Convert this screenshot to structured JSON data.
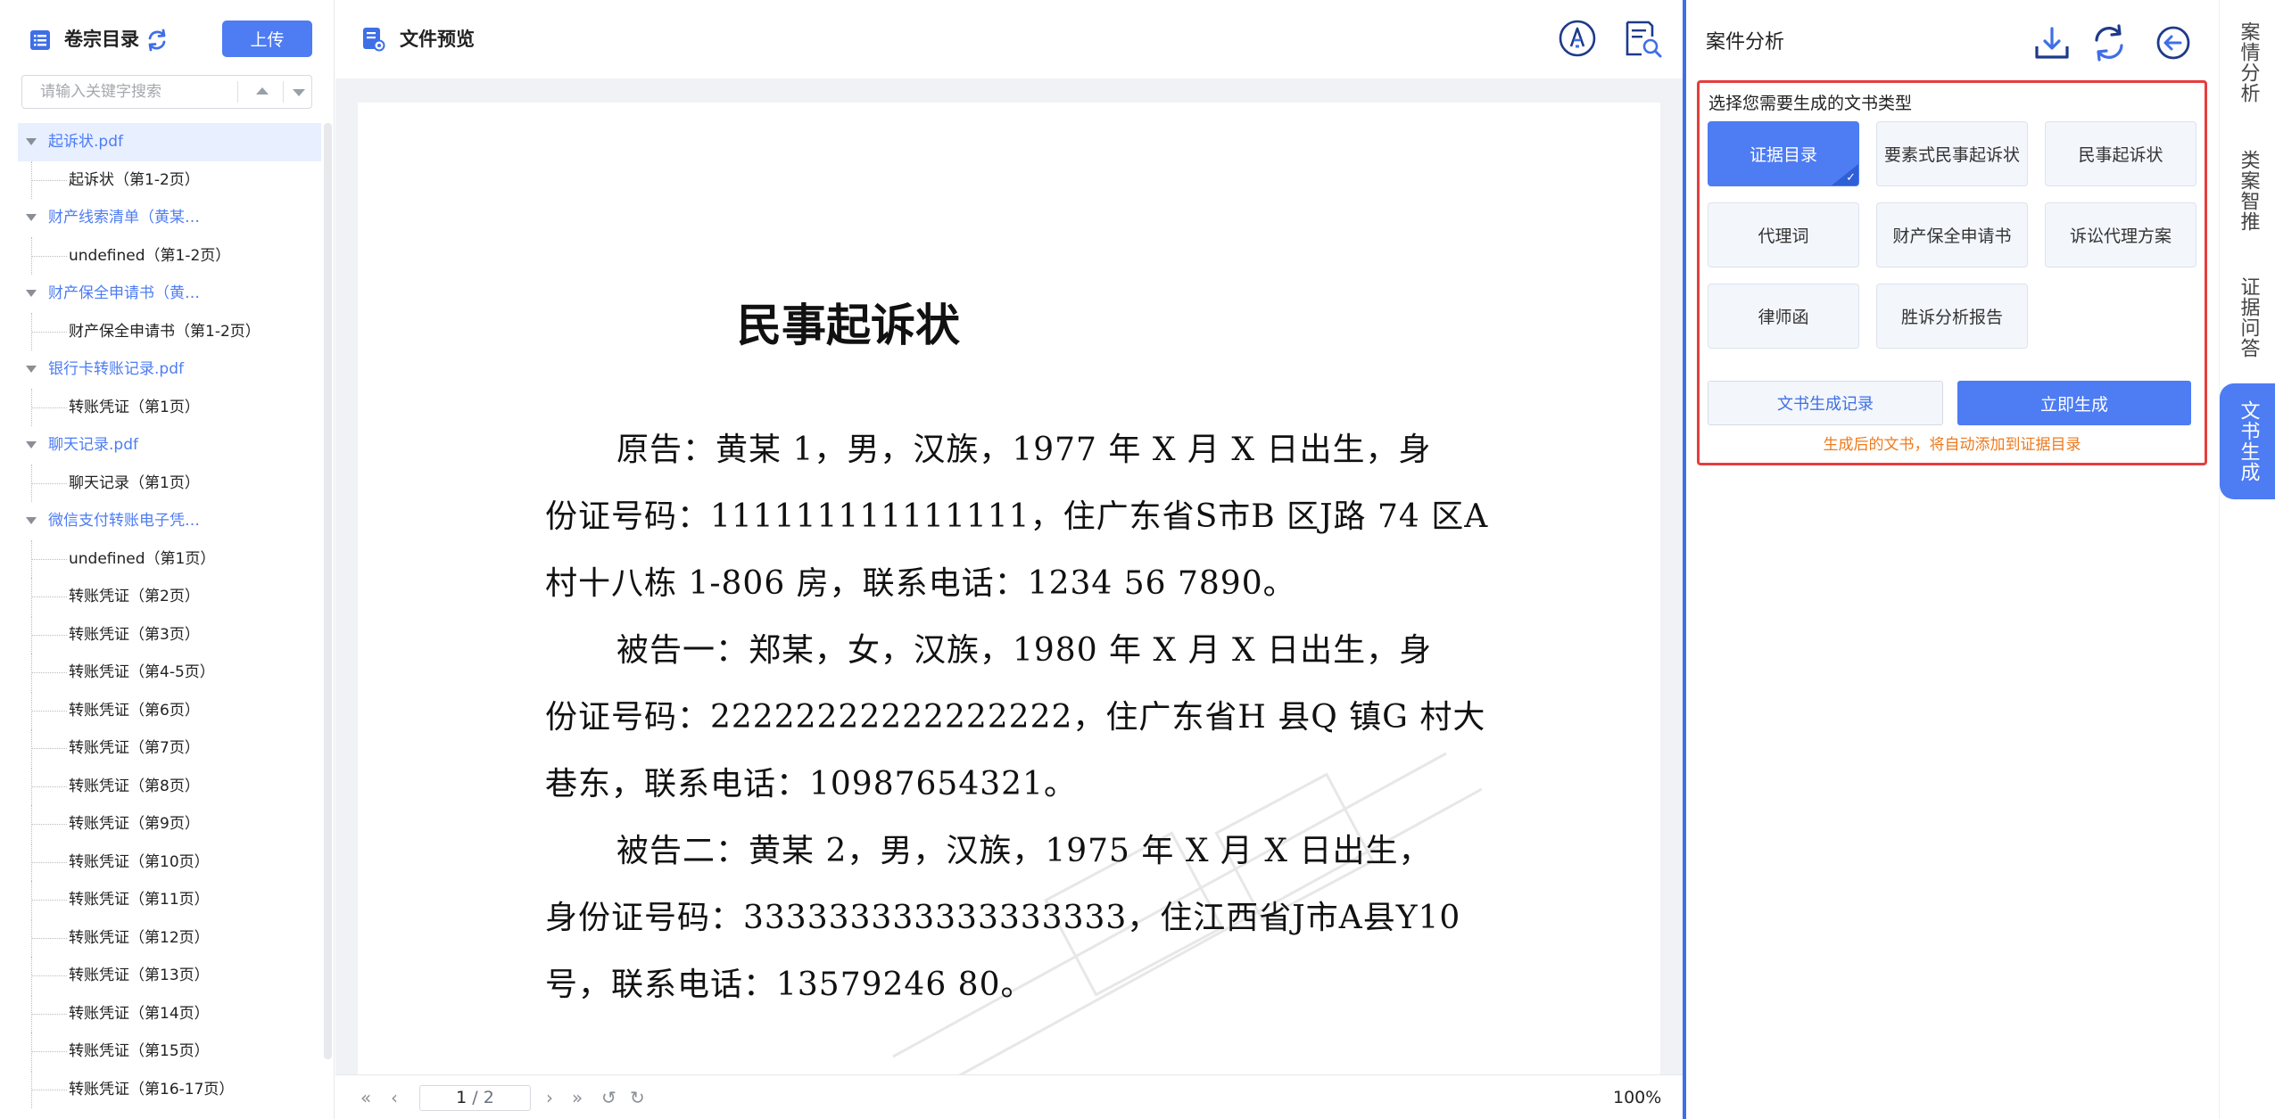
{
  "left": {
    "title": "卷宗目录",
    "upload_label": "上传",
    "search_placeholder": "请输入关键字搜索",
    "tree": [
      {
        "type": "parent",
        "label": "起诉状.pdf",
        "selected": true
      },
      {
        "type": "child",
        "label": "起诉状（第1-2页）"
      },
      {
        "type": "parent",
        "label": "财产线索清单（黄某…"
      },
      {
        "type": "child",
        "label": "undefined（第1-2页）"
      },
      {
        "type": "parent",
        "label": "财产保全申请书（黄…"
      },
      {
        "type": "child",
        "label": "财产保全申请书（第1-2页）"
      },
      {
        "type": "parent",
        "label": "银行卡转账记录.pdf"
      },
      {
        "type": "child",
        "label": "转账凭证（第1页）"
      },
      {
        "type": "parent",
        "label": "聊天记录.pdf"
      },
      {
        "type": "child",
        "label": "聊天记录（第1页）"
      },
      {
        "type": "parent",
        "label": "微信支付转账电子凭…"
      },
      {
        "type": "child",
        "label": "undefined（第1页）"
      },
      {
        "type": "child",
        "label": "转账凭证（第2页）"
      },
      {
        "type": "child",
        "label": "转账凭证（第3页）"
      },
      {
        "type": "child",
        "label": "转账凭证（第4-5页）"
      },
      {
        "type": "child",
        "label": "转账凭证（第6页）"
      },
      {
        "type": "child",
        "label": "转账凭证（第7页）"
      },
      {
        "type": "child",
        "label": "转账凭证（第8页）"
      },
      {
        "type": "child",
        "label": "转账凭证（第9页）"
      },
      {
        "type": "child",
        "label": "转账凭证（第10页）"
      },
      {
        "type": "child",
        "label": "转账凭证（第11页）"
      },
      {
        "type": "child",
        "label": "转账凭证（第12页）"
      },
      {
        "type": "child",
        "label": "转账凭证（第13页）"
      },
      {
        "type": "child",
        "label": "转账凭证（第14页）"
      },
      {
        "type": "child",
        "label": "转账凭证（第15页）"
      },
      {
        "type": "child",
        "label": "转账凭证（第16-17页）"
      }
    ]
  },
  "center": {
    "title": "文件预览",
    "document": {
      "title": "民事起诉状",
      "lines": [
        {
          "text": "原告：黄某 1，男，汉族，1977 年 X 月 X 日出生，身",
          "indent": true
        },
        {
          "text": "份证号码：111111111111111，住广东省S市B 区J路 74 区A",
          "indent": false
        },
        {
          "text": "村十八栋 1-806 房，联系电话：1234 56 7890。",
          "indent": false
        },
        {
          "text": "被告一：郑某，女，汉族，1980 年 X 月 X 日出生，身",
          "indent": true
        },
        {
          "text": "份证号码：22222222222222222，住广东省H 县Q 镇G 村大",
          "indent": false
        },
        {
          "text": "巷东，联系电话：10987654321。",
          "indent": false
        },
        {
          "text": "被告二：黄某 2，男，汉族，1975 年 X 月 X 日出生，",
          "indent": true
        },
        {
          "text": "身份证号码：333333333333333333，住江西省J市A县Y10",
          "indent": false
        },
        {
          "text": "号，联系电话：13579246 80。",
          "indent": false
        }
      ]
    },
    "pager": {
      "current": "1",
      "separator": " / ",
      "total": "2",
      "zoom": "100%"
    }
  },
  "right": {
    "title": "案件分析",
    "choose_label": "选择您需要生成的文书类型",
    "doc_types": [
      {
        "label": "证据目录",
        "active": true
      },
      {
        "label": "要素式民事起诉状",
        "active": false
      },
      {
        "label": "民事起诉状",
        "active": false
      },
      {
        "label": "代理词",
        "active": false
      },
      {
        "label": "财产保全申请书",
        "active": false
      },
      {
        "label": "诉讼代理方案",
        "active": false
      },
      {
        "label": "律师函",
        "active": false
      },
      {
        "label": "胜诉分析报告",
        "active": false
      }
    ],
    "history_label": "文书生成记录",
    "generate_label": "立即生成",
    "hint": "生成后的文书，将自动添加到证据目录"
  },
  "vtabs": [
    {
      "label": "案情分析",
      "active": false
    },
    {
      "label": "类案智推",
      "active": false
    },
    {
      "label": "证据问答",
      "active": false
    },
    {
      "label": "文书生成",
      "active": true
    }
  ],
  "colors": {
    "accent": "#4d7cf3",
    "highlight_border": "#e53e3e",
    "hint": "#ef7a1d"
  }
}
